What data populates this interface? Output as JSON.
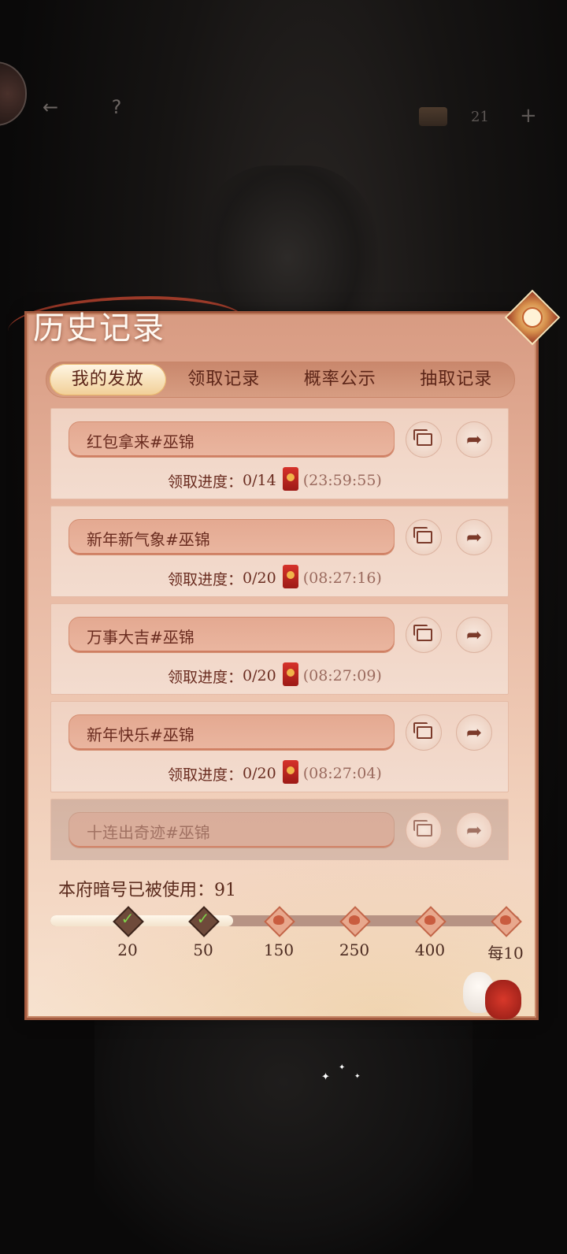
{
  "top_bar": {
    "back_icon": "back-arrow-icon",
    "help_label": "?",
    "currency_count": "21",
    "add_label": "+"
  },
  "panel": {
    "title": "历史记录",
    "tabs": [
      {
        "label": "我的发放",
        "active": true
      },
      {
        "label": "领取记录",
        "active": false
      },
      {
        "label": "概率公示",
        "active": false
      },
      {
        "label": "抽取记录",
        "active": false
      }
    ]
  },
  "records": [
    {
      "name": "红包拿来#巫锦",
      "progress_label": "领取进度：",
      "progress": "0/14",
      "time": "(23:59:55)"
    },
    {
      "name": "新年新气象#巫锦",
      "progress_label": "领取进度：",
      "progress": "0/20",
      "time": "(08:27:16)"
    },
    {
      "name": "万事大吉#巫锦",
      "progress_label": "领取进度：",
      "progress": "0/20",
      "time": "(08:27:09)"
    },
    {
      "name": "新年快乐#巫锦",
      "progress_label": "领取进度：",
      "progress": "0/20",
      "time": "(08:27:04)"
    },
    {
      "name": "十连出奇迹#巫锦"
    }
  ],
  "footer": {
    "used_label": "本府暗号已被使用：91",
    "milestones": [
      {
        "label": "20",
        "done": true
      },
      {
        "label": "50",
        "done": true
      },
      {
        "label": "150",
        "done": false
      },
      {
        "label": "250",
        "done": false
      },
      {
        "label": "400",
        "done": false
      },
      {
        "label": "每10",
        "done": false
      }
    ],
    "progress_fraction": 0.39
  },
  "colors": {
    "panel_top": "#d89b82",
    "panel_bottom": "#f7e2cf",
    "text_dark": "#6a2c20",
    "accent_red": "#c0452f"
  }
}
